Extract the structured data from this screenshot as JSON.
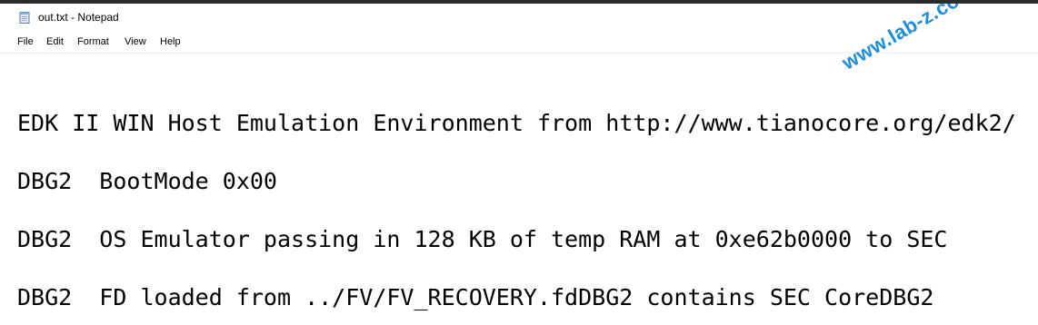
{
  "window": {
    "title": "out.txt - Notepad",
    "icon": "notepad-icon"
  },
  "menu": {
    "file": "File",
    "edit": "Edit",
    "format": "Format",
    "view": "View",
    "help": "Help"
  },
  "editor": {
    "lines": [
      "EDK II WIN Host Emulation Environment from http://www.tianocore.org/edk2/",
      "DBG2  BootMode 0x00",
      "DBG2  OS Emulator passing in 128 KB of temp RAM at 0xe62b0000 to SEC",
      "DBG2  FD loaded from ../FV/FV_RECOVERY.fdDBG2 contains SEC CoreDBG2"
    ]
  },
  "watermark": {
    "text": "www.lab-z.com",
    "color": "#1a8fe0"
  }
}
